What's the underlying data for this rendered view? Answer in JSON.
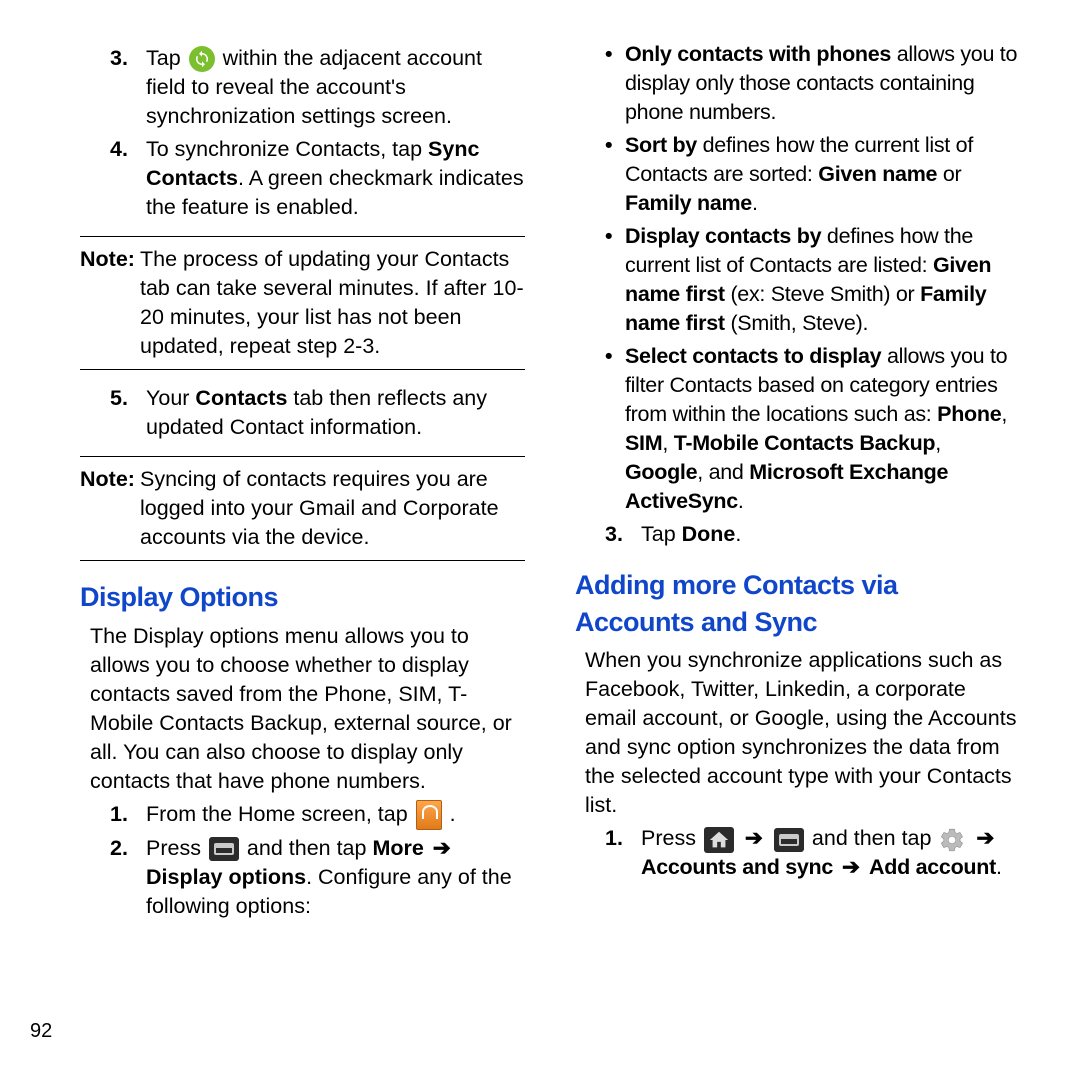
{
  "left": {
    "step3": {
      "num": "3.",
      "pre": "Tap ",
      "post": " within the adjacent account field to reveal the account's synchronization settings screen."
    },
    "step4": {
      "num": "4.",
      "t1": "To synchronize Contacts, tap ",
      "b1": "Sync Contacts",
      "t2": ". A green checkmark indicates the feature is enabled."
    },
    "note1": {
      "label": "Note:",
      "body": "The process of updating your Contacts tab can take several minutes. If after 10-20 minutes, your list has not been updated, repeat step 2-3."
    },
    "step5": {
      "num": "5.",
      "t1": "Your ",
      "b1": "Contacts",
      "t2": " tab then reflects any updated Contact information."
    },
    "note2": {
      "label": "Note:",
      "body": "Syncing of contacts requires you are logged into your Gmail and Corporate accounts via the device."
    },
    "h_display": "Display Options",
    "display_intro": "The Display options menu allows you to allows you to choose whether to display contacts saved from the Phone, SIM, T-Mobile Contacts Backup, external source, or all. You can also choose to display only contacts that have phone numbers.",
    "d_step1": {
      "num": "1.",
      "text": "From the Home screen, tap ",
      "after": " ."
    },
    "d_step2": {
      "num": "2.",
      "t1": "Press ",
      "t2": " and then tap ",
      "b1": "More",
      "arrow": " ➔ ",
      "b2": "Display options",
      "t3": ". Configure any of the following options:"
    }
  },
  "right": {
    "bullets": [
      {
        "b": "Only contacts with phones",
        "t": " allows you to display only those contacts containing phone numbers."
      },
      {
        "b": "Sort by",
        "t": " defines how the current list of Contacts are sorted: ",
        "b2": "Given name",
        "mid": " or ",
        "b3": "Family name",
        "end": "."
      },
      {
        "b": "Display contacts by",
        "t": " defines how the current list of Contacts are listed: ",
        "b2": "Given name first",
        "mid": " (ex: Steve Smith) or ",
        "b3": "Family name first",
        "end": " (Smith, Steve)."
      },
      {
        "b": "Select contacts to display",
        "t": " allows you to filter Contacts based on category entries from within the locations such as: ",
        "b2": "Phone",
        "c1": ", ",
        "b3": "SIM",
        "c2": ", ",
        "b4": "T-Mobile Contacts Backup",
        "c3": ", ",
        "b5": "Google",
        "c4": ", and ",
        "b6": "Microsoft Exchange ActiveSync",
        "end": "."
      }
    ],
    "step3": {
      "num": "3.",
      "t1": "Tap ",
      "b1": "Done",
      "t2": "."
    },
    "h_adding": "Adding more Contacts via Accounts and Sync",
    "add_intro": "When you synchronize applications such as Facebook, Twitter, Linkedin, a corporate email account, or Google, using the Accounts and sync option synchronizes the data from the selected account type with your Contacts list.",
    "a_step1": {
      "num": "1.",
      "t1": "Press ",
      "arrow1": " ➔ ",
      "t2": " and then tap ",
      "arrow2": " ➔ ",
      "b1": "Accounts and sync",
      "arrow3": " ➔ ",
      "b2": "Add account",
      "t3": "."
    }
  },
  "page_number": "92"
}
